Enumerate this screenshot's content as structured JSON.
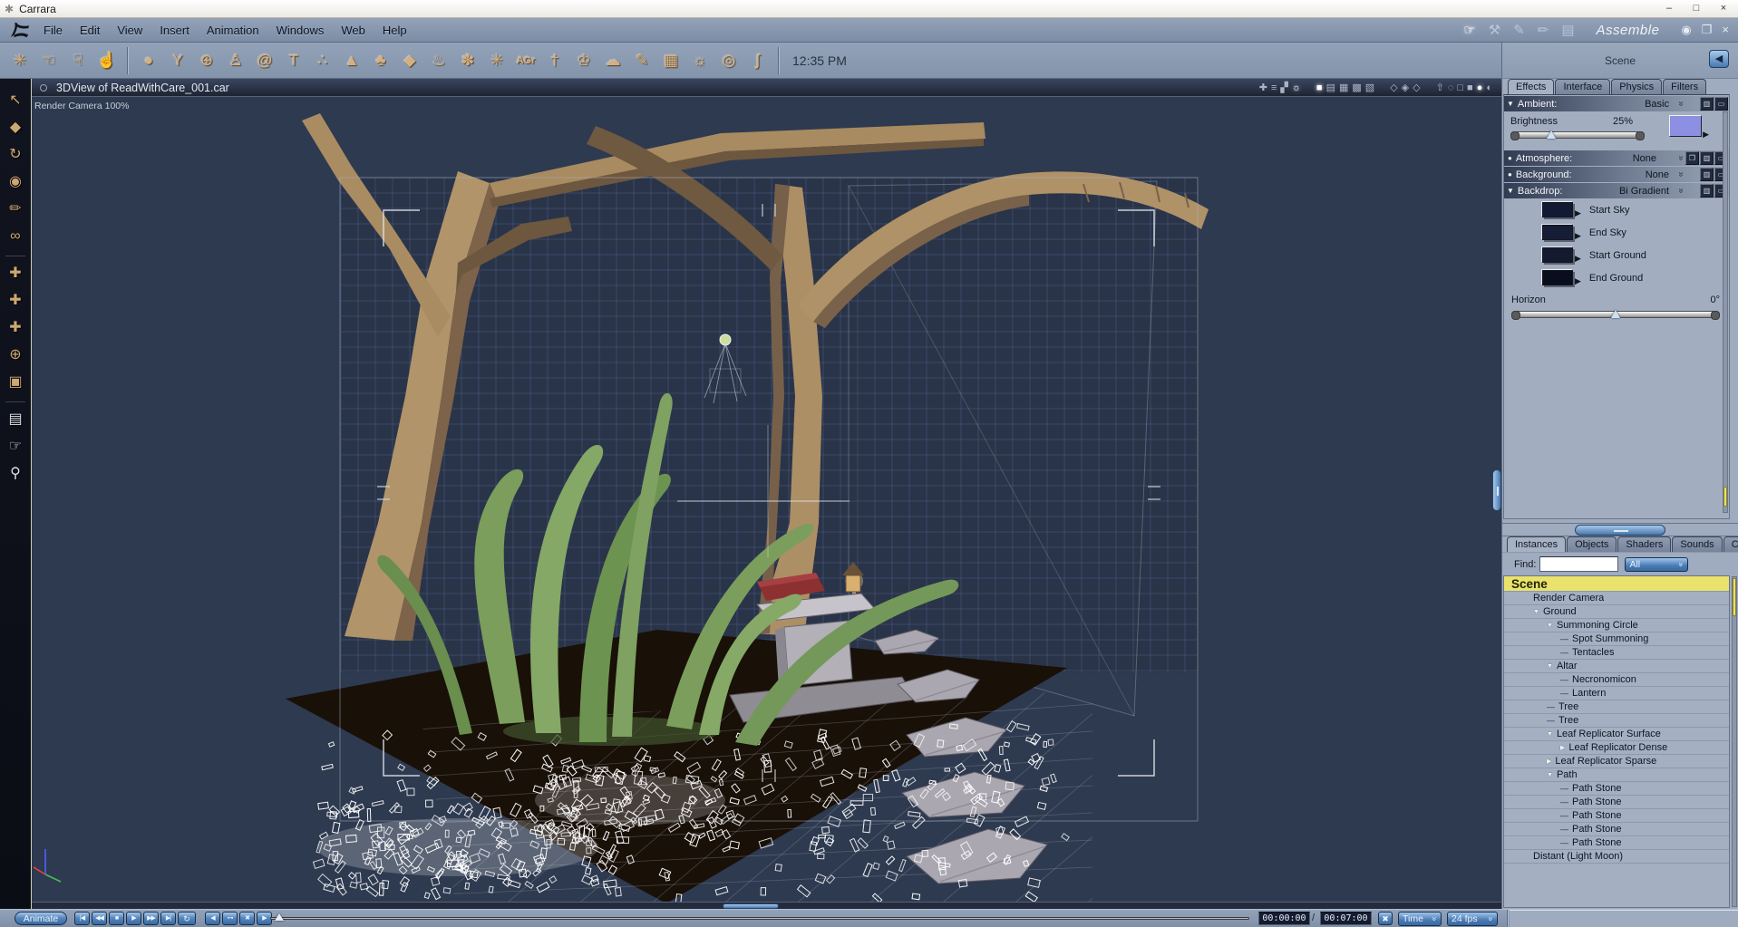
{
  "window": {
    "title": "Carrara",
    "app_icon_glyph": "✱",
    "controls": [
      {
        "name": "minimize-button",
        "glyph": "–"
      },
      {
        "name": "maximize-button",
        "glyph": "□"
      },
      {
        "name": "close-button",
        "glyph": "×"
      }
    ]
  },
  "menu_bar": {
    "items": [
      "File",
      "Edit",
      "View",
      "Insert",
      "Animation",
      "Windows",
      "Web",
      "Help"
    ]
  },
  "mode_bar": {
    "mode_label": "Assemble",
    "rooms": [
      {
        "name": "assemble-room-icon",
        "glyph": "☞",
        "active": true
      },
      {
        "name": "model-room-icon",
        "glyph": "⚒"
      },
      {
        "name": "texture-room-icon",
        "glyph": "✎"
      },
      {
        "name": "render-room-icon",
        "glyph": "✏"
      },
      {
        "name": "animation-room-icon",
        "glyph": "▤"
      }
    ],
    "icons": [
      {
        "name": "eye-icon",
        "glyph": "◉"
      },
      {
        "name": "window-icon",
        "glyph": "❐"
      },
      {
        "name": "close-icon",
        "glyph": "×"
      }
    ]
  },
  "toolbar": {
    "clock": "12:35 PM",
    "group1": [
      {
        "name": "universal-manipulator-icon",
        "glyph": "✳"
      },
      {
        "name": "pan-hand-tool-icon",
        "glyph": "☜"
      },
      {
        "name": "gesture-tool-icon",
        "glyph": "☟"
      },
      {
        "name": "point-tool-icon",
        "glyph": "☝"
      }
    ],
    "group2": [
      {
        "name": "insert-sphere-icon",
        "glyph": "●"
      },
      {
        "name": "insert-vertex-object-icon",
        "glyph": "Y"
      },
      {
        "name": "insert-spline-object-icon",
        "glyph": "⊕"
      },
      {
        "name": "insert-character-icon",
        "glyph": "♙"
      },
      {
        "name": "insert-metaball-icon",
        "glyph": "@"
      },
      {
        "name": "insert-text-icon",
        "glyph": "T"
      },
      {
        "name": "insert-particle-emitter-icon",
        "glyph": "∴"
      },
      {
        "name": "insert-terrain-icon",
        "glyph": "▲"
      },
      {
        "name": "insert-plant-icon",
        "glyph": "♣"
      },
      {
        "name": "insert-rock-icon",
        "glyph": "◆"
      },
      {
        "name": "insert-fire-icon",
        "glyph": "♨"
      },
      {
        "name": "insert-flower-icon",
        "glyph": "✽"
      },
      {
        "name": "insert-hair-icon",
        "glyph": "✳"
      },
      {
        "name": "insert-auto-group-icon",
        "glyph": "AGr",
        "text": true
      },
      {
        "name": "insert-nail-icon",
        "glyph": "†"
      },
      {
        "name": "insert-crown-icon",
        "glyph": "♔"
      },
      {
        "name": "insert-blob-icon",
        "glyph": "☁"
      },
      {
        "name": "insert-brush-icon",
        "glyph": "✎"
      },
      {
        "name": "insert-camera-icon",
        "glyph": "▦"
      },
      {
        "name": "insert-light-icon",
        "glyph": "☼"
      },
      {
        "name": "insert-target-icon",
        "glyph": "◎"
      },
      {
        "name": "insert-bone-icon",
        "glyph": "∫"
      }
    ]
  },
  "left_toolbar": {
    "tools": [
      {
        "name": "select-tool-icon",
        "glyph": "↖"
      },
      {
        "name": "move-tool-icon",
        "glyph": "◆"
      },
      {
        "name": "rotate-tool-icon",
        "glyph": "↻"
      },
      {
        "name": "scale-tool-icon",
        "glyph": "◉"
      },
      {
        "name": "eyedropper-tool-icon",
        "glyph": "✏"
      },
      {
        "name": "link-tool-icon",
        "glyph": "∞"
      },
      {
        "name": "divider"
      },
      {
        "name": "translate-xy-tool-icon",
        "glyph": "✚"
      },
      {
        "name": "translate-xz-tool-icon",
        "glyph": "✚"
      },
      {
        "name": "translate-yz-tool-icon",
        "glyph": "✚"
      },
      {
        "name": "center-hotpoint-tool-icon",
        "glyph": "⊕"
      },
      {
        "name": "working-box-icon",
        "glyph": "▣"
      },
      {
        "name": "divider"
      },
      {
        "name": "render-preview-icon",
        "glyph": "▤",
        "white": true
      },
      {
        "name": "pan-view-hand-icon",
        "glyph": "☞",
        "white": true
      },
      {
        "name": "zoom-magnifier-icon",
        "glyph": "⚲",
        "white": true
      }
    ]
  },
  "viewport": {
    "title": "3DView of ReadWithCare_001.car",
    "camera_label": "Render Camera 100%",
    "header_icons": [
      {
        "name": "drag-tool-icon",
        "glyph": "✚"
      },
      {
        "name": "hierarchy-icon",
        "glyph": "≡"
      },
      {
        "name": "camera-group-icon",
        "glyph": "▞"
      },
      {
        "name": "render-preview-sphere-icon",
        "glyph": "☼",
        "active": true
      },
      {
        "name": "layout-single-pane-icon",
        "glyph": "■",
        "active": true,
        "gap": true
      },
      {
        "name": "layout-two-pane-icon",
        "glyph": "▤"
      },
      {
        "name": "layout-three-pane-icon",
        "glyph": "▦"
      },
      {
        "name": "layout-four-pane-icon",
        "glyph": "▩"
      },
      {
        "name": "layout-custom-pane-icon",
        "glyph": "▧"
      },
      {
        "name": "axis-display-icon",
        "glyph": "◇",
        "gap": true
      },
      {
        "name": "grid-display-icon",
        "glyph": "◈"
      },
      {
        "name": "backdrop-display-icon",
        "glyph": "◇"
      },
      {
        "name": "up-axis-icon",
        "glyph": "⇧",
        "gap": true
      },
      {
        "name": "wireframe-head-icon",
        "glyph": "◌"
      },
      {
        "name": "wireframe-cube-icon",
        "glyph": "□"
      },
      {
        "name": "flat-shaded-icon",
        "glyph": "■"
      },
      {
        "name": "smooth-shaded-icon",
        "glyph": "●",
        "active": true
      },
      {
        "name": "textured-shaded-icon",
        "glyph": "◐"
      }
    ]
  },
  "effects_panel": {
    "scene_label": "Scene",
    "back_button_glyph": "◀",
    "tabs": [
      {
        "label": "Effects",
        "active": true
      },
      {
        "label": "Interface"
      },
      {
        "label": "Physics"
      },
      {
        "label": "Filters"
      }
    ],
    "ambient": {
      "label": "Ambient:",
      "value": "Basic",
      "brightness_label": "Brightness",
      "brightness_value": "25%",
      "swatch_color": "#8d8fe2",
      "slider_pos": 0.3
    },
    "atmosphere": {
      "label": "Atmosphere:",
      "value": "None"
    },
    "background": {
      "label": "Background:",
      "value": "None"
    },
    "backdrop": {
      "label": "Backdrop:",
      "value": "Bi Gradient",
      "swatches": [
        {
          "label": "Start Sky",
          "color": "#121933"
        },
        {
          "label": "End Sky",
          "color": "#161d36"
        },
        {
          "label": "Start Ground",
          "color": "#131a30"
        },
        {
          "label": "End Ground",
          "color": "#0a0d1d"
        }
      ],
      "horizon_label": "Horizon",
      "horizon_value": "0°",
      "horizon_slider_pos": 0.5
    }
  },
  "browser_panel": {
    "tabs": [
      {
        "label": "Instances",
        "active": true
      },
      {
        "label": "Objects"
      },
      {
        "label": "Shaders"
      },
      {
        "label": "Sounds"
      },
      {
        "label": "Clips"
      }
    ],
    "find_label": "Find:",
    "find_value": "",
    "filter_value": "All",
    "tree": [
      {
        "label": "Scene",
        "depth": 0,
        "selected": true
      },
      {
        "label": "Render Camera",
        "depth": 1
      },
      {
        "label": "Ground",
        "depth": 1,
        "expand": "open"
      },
      {
        "label": "Summoning Circle",
        "depth": 2,
        "expand": "open"
      },
      {
        "label": "Spot Summoning",
        "depth": 3,
        "connector": true
      },
      {
        "label": "Tentacles",
        "depth": 3,
        "connector": true
      },
      {
        "label": "Altar",
        "depth": 2,
        "expand": "open"
      },
      {
        "label": "Necronomicon",
        "depth": 3,
        "connector": true
      },
      {
        "label": "Lantern",
        "depth": 3,
        "connector": true
      },
      {
        "label": "Tree",
        "depth": 2,
        "connector": true
      },
      {
        "label": "Tree",
        "depth": 2,
        "connector": true
      },
      {
        "label": "Leaf Replicator Surface",
        "depth": 2,
        "expand": "open"
      },
      {
        "label": "Leaf Replicator Dense",
        "depth": 3,
        "expand": "closed"
      },
      {
        "label": "Leaf Replicator Sparse",
        "depth": 2,
        "expand": "closed"
      },
      {
        "label": "Path",
        "depth": 2,
        "expand": "open"
      },
      {
        "label": "Path Stone",
        "depth": 3,
        "connector": true
      },
      {
        "label": "Path Stone",
        "depth": 3,
        "connector": true
      },
      {
        "label": "Path Stone",
        "depth": 3,
        "connector": true
      },
      {
        "label": "Path Stone",
        "depth": 3,
        "connector": true
      },
      {
        "label": "Path Stone",
        "depth": 3,
        "connector": true
      },
      {
        "label": "Distant (Light Moon)",
        "depth": 1
      }
    ]
  },
  "timeline_bar": {
    "animate_label": "Animate",
    "transport": [
      {
        "name": "go-start-button",
        "glyph": "|◀"
      },
      {
        "name": "rewind-button",
        "glyph": "◀◀"
      },
      {
        "name": "stop-button",
        "glyph": "■"
      },
      {
        "name": "play-button",
        "glyph": "▶"
      },
      {
        "name": "fast-forward-button",
        "glyph": "▶▶"
      },
      {
        "name": "go-end-button",
        "glyph": "▶|"
      }
    ],
    "loop_glyph": "↻",
    "keyframe_buttons": [
      {
        "name": "prev-keyframe-button",
        "glyph": "◀"
      },
      {
        "name": "add-keyframe-button",
        "glyph": "⊶"
      },
      {
        "name": "delete-keyframe-button",
        "glyph": "✖"
      },
      {
        "name": "next-keyframe-button",
        "glyph": "▶"
      }
    ],
    "current_time": "00:00:00",
    "time_separator": "/",
    "end_time": "00:07:00",
    "cancel_glyph": "✖",
    "time_mode": "Time",
    "fps": "24 fps"
  },
  "colors": {
    "accent_blue": "#4a7ab5",
    "selection_yellow": "#e9e26b",
    "viewport_bg": "#2e3a50",
    "panel_bg": "#9fabbe",
    "tan_icon": "#d3b084"
  }
}
